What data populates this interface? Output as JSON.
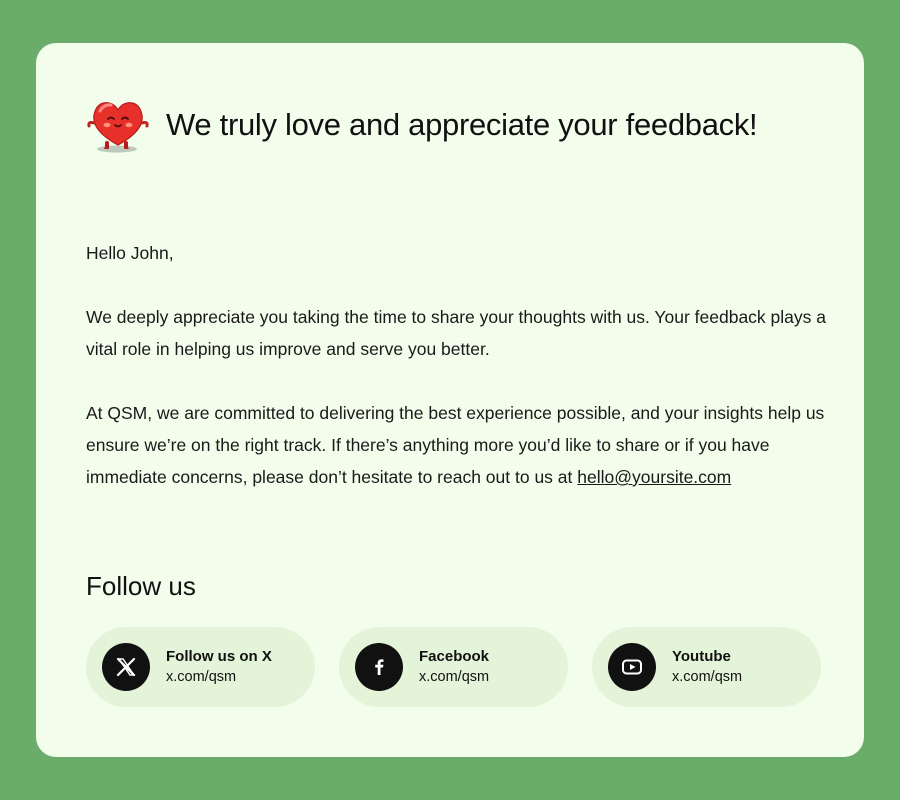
{
  "header": {
    "title": "We truly love and appreciate your feedback!",
    "icon": "heart-mascot-icon"
  },
  "body": {
    "greeting": "Hello John,",
    "paragraph1": "We deeply appreciate you taking the time to share your thoughts with us. Your feedback plays a vital role in helping us improve and serve you better.",
    "paragraph2": "At QSM, we are committed to delivering the best experience possible, and your insights help us ensure we’re on the right track. If there’s anything more you’d like to share or if you have immediate concerns, please don’t hesitate to reach out to us at",
    "email": "hello@yoursite.com"
  },
  "follow": {
    "title": "Follow us",
    "items": [
      {
        "name": "Follow us on X",
        "url": "x.com/qsm",
        "icon": "x-icon"
      },
      {
        "name": "Facebook",
        "url": "x.com/qsm",
        "icon": "facebook-icon"
      },
      {
        "name": "Youtube",
        "url": "x.com/qsm",
        "icon": "youtube-icon"
      }
    ]
  },
  "colors": {
    "background": "#6aad6b",
    "card": "#f3fdec",
    "pill": "#e3f4d9",
    "icon_circle": "#111111",
    "heart": "#e8302a"
  }
}
